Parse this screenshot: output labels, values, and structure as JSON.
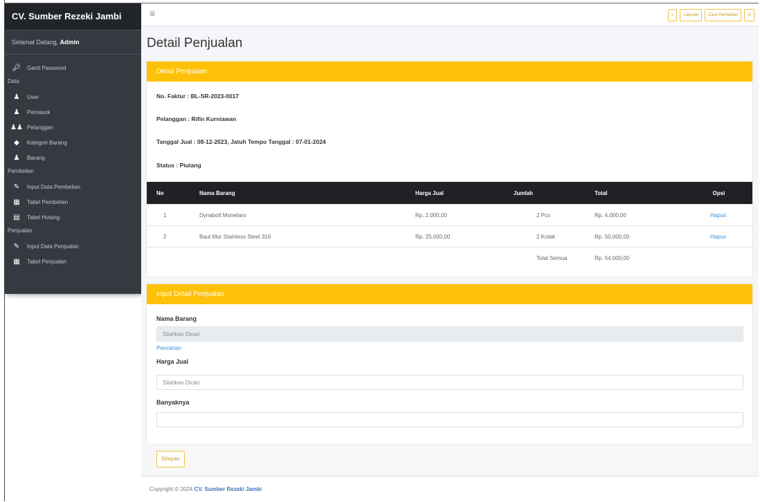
{
  "sidebar": {
    "brand": "CV. Sumber Rezeki Jambi",
    "welcome_prefix": "Selamat Datang, ",
    "welcome_user": "Admin",
    "items": [
      {
        "label": "Ganti Password",
        "icon": "key-icon"
      },
      {
        "heading": "Data"
      },
      {
        "label": "User",
        "icon": "users-icon"
      },
      {
        "label": "Pemasok",
        "icon": "user-icon"
      },
      {
        "label": "Pelanggan",
        "icon": "users-icon"
      },
      {
        "label": "Kategori Barang",
        "icon": "tag-icon"
      },
      {
        "label": "Barang",
        "icon": "users-icon"
      },
      {
        "heading": "Pembelian"
      },
      {
        "label": "Input Data Pembelian",
        "icon": "pen-icon"
      },
      {
        "label": "Tabel Pembelian",
        "icon": "table-icon"
      },
      {
        "label": "Tabel Hutang",
        "icon": "table-icon"
      },
      {
        "heading": "Penjualan"
      },
      {
        "label": "Input Data Penjualan",
        "icon": "pen-icon"
      },
      {
        "label": "Tabel Penjualan",
        "icon": "table-icon"
      }
    ]
  },
  "navbar": {
    "menu_icon": "menu-icon",
    "home_icon": "home-icon",
    "laporan": "Laporan",
    "cara_pembelian": "Cara Pembelian",
    "power_icon": "power-icon"
  },
  "page": {
    "title": "Detail Penjualan"
  },
  "detail_card": {
    "header": "Detail Penjualan",
    "no_faktur": "No. Faktur : BL-SR-2023-0017",
    "pelanggan": "Pelanggan : Rifin Kurniawan",
    "tanggal": "Tanggal Jual : 08-12-2023, Jatuh Tempo Tanggal : 07-01-2024",
    "status": "Status : Piutang"
  },
  "table": {
    "headers": [
      "No",
      "Nama Barang",
      "Harga Jual",
      "Jumlah",
      "Total",
      "Opsi"
    ],
    "rows": [
      {
        "no": "1",
        "nama": "Dynabolt Monetaro",
        "harga": "Rp. 2.000,00",
        "jumlah": "2 Pcs",
        "total": "Rp. 4.000,00",
        "opsi": "Hapus"
      },
      {
        "no": "2",
        "nama": "Baut Mur Stainless Steel 316",
        "harga": "Rp. 25.000,00",
        "jumlah": "2 Kotak",
        "total": "Rp. 50.000,00",
        "opsi": "Hapus"
      }
    ],
    "total_label": "Total Semua",
    "total_value": "Rp. 54.000,00"
  },
  "input_card": {
    "header": "Input Detail Penjualan",
    "nama_label": "Nama Barang",
    "nama_placeholder": "Silahkan Dicari",
    "pencarian": "Pencarian",
    "harga_label": "Harga Jual",
    "harga_placeholder": "Silahkan Dicari",
    "banyak_label": "Banyaknya",
    "banyak_value": "",
    "save": "Simpan"
  },
  "footer": {
    "prefix": "Copyright © 2024 ",
    "company": "CV. Sumber Rezeki Jambi"
  },
  "colors": {
    "accent": "#ffc107",
    "sidebar": "#343a40",
    "link": "#3b8bd6"
  }
}
